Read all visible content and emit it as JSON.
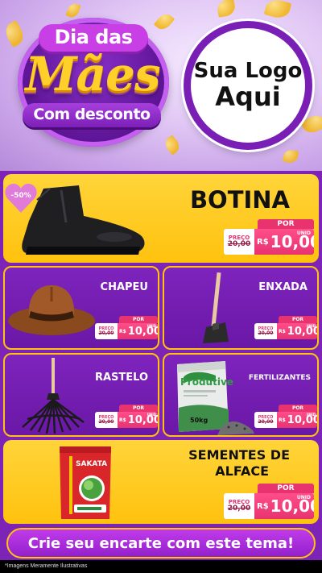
{
  "header": {
    "title_line1": "Dia das",
    "title_line2": "Mães",
    "title_line3": "Com desconto",
    "logo_line1": "Sua Logo",
    "logo_line2": "Aqui"
  },
  "discount_badge": "-50%",
  "price_labels": {
    "por": "POR",
    "preco": "PREÇO",
    "currency": "R$",
    "unid": "UNID"
  },
  "products": [
    {
      "name": "BOTINA",
      "old_price": "20,00",
      "new_price": "10,00"
    },
    {
      "name": "CHAPEU",
      "old_price": "20,00",
      "new_price": "10,00"
    },
    {
      "name": "ENXADA",
      "old_price": "20,00",
      "new_price": "10,00"
    },
    {
      "name": "RASTELO",
      "old_price": "20,00",
      "new_price": "10,00"
    },
    {
      "name": "FERTILIZANTES",
      "old_price": "20,00",
      "new_price": "10,00",
      "package_brand": "Produtive",
      "package_weight": "50kg"
    },
    {
      "name_line1": "SEMENTES DE",
      "name_line2": "ALFACE",
      "old_price": "20,00",
      "new_price": "10,00",
      "package_brand": "SAKATA"
    }
  ],
  "cta": "Crie seu encarte com este tema!",
  "footer_note": "*Imagens Meramente Ilustrativas",
  "colors": {
    "purple": "#7d23b8",
    "yellow": "#ffc20e",
    "pink": "#e8336f"
  }
}
